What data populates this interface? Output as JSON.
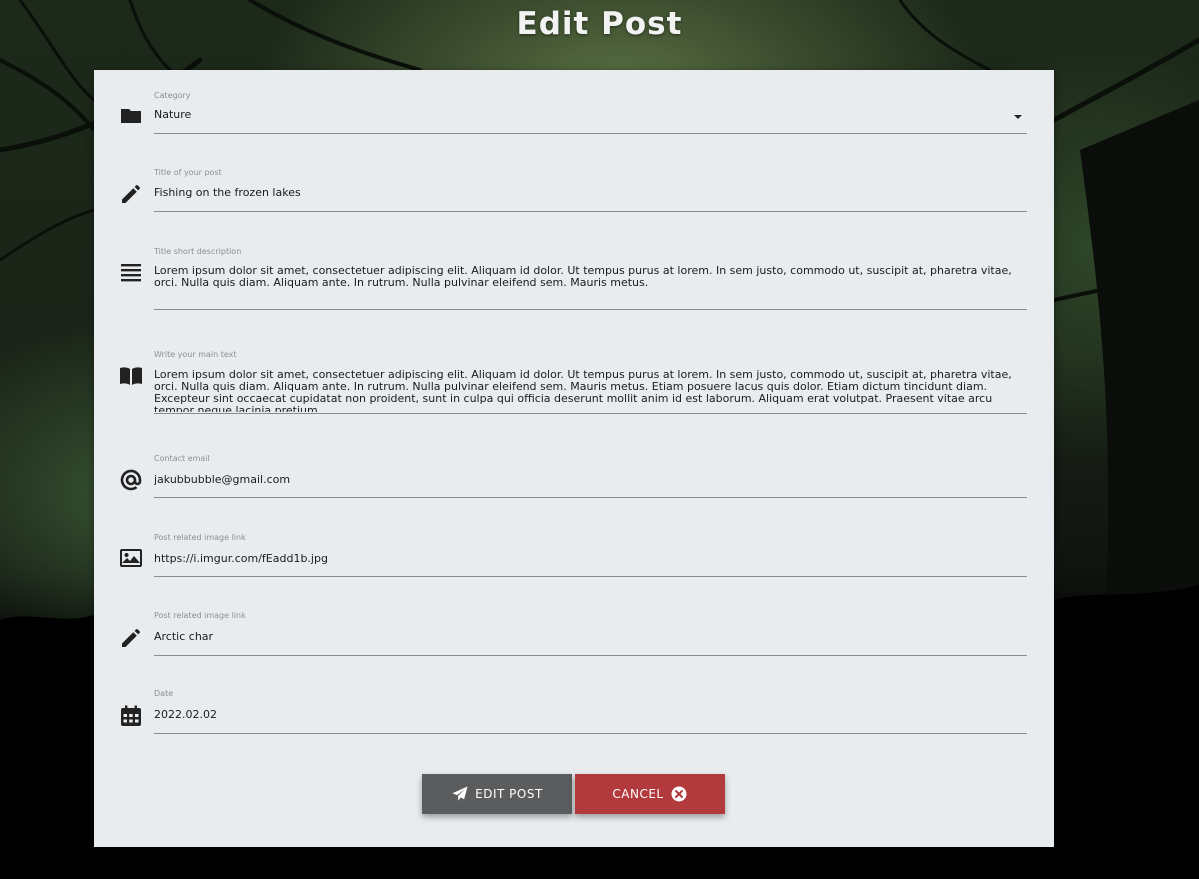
{
  "page": {
    "title": "Edit Post"
  },
  "form": {
    "fields": [
      {
        "label": "Category",
        "value": "Nature",
        "icon": "folder-icon"
      },
      {
        "label": "Title of your post",
        "value": "Fishing on the frozen lakes",
        "icon": "pencil-icon"
      },
      {
        "label": "Title short description",
        "value": "Lorem ipsum dolor sit amet, consectetuer adipiscing elit. Aliquam id dolor. Ut tempus purus at lorem. In sem justo, commodo ut, suscipit at, pharetra vitae, orci. Nulla quis diam. Aliquam ante. In rutrum. Nulla pulvinar eleifend sem. Mauris metus.",
        "icon": "align-justify-icon"
      },
      {
        "label": "Write your main text",
        "value": "Lorem ipsum dolor sit amet, consectetuer adipiscing elit. Aliquam id dolor. Ut tempus purus at lorem. In sem justo, commodo ut, suscipit at, pharetra vitae, orci. Nulla quis diam. Aliquam ante. In rutrum. Nulla pulvinar eleifend sem. Mauris metus. Etiam posuere lacus quis dolor. Etiam dictum tincidunt diam. Excepteur sint occaecat cupidatat non proident, sunt in culpa qui officia deserunt mollit anim id est laborum. Aliquam erat volutpat. Praesent vitae arcu tempor neque lacinia pretium.",
        "icon": "book-icon"
      },
      {
        "label": "Contact email",
        "value": "jakubbubble@gmail.com",
        "icon": "at-icon"
      },
      {
        "label": "Post related image link",
        "value": "https://i.imgur.com/fEadd1b.jpg",
        "icon": "image-icon"
      },
      {
        "label": "Post related image link",
        "value": "Arctic char",
        "icon": "pencil-icon"
      },
      {
        "label": "Date",
        "value": "2022.02.02",
        "icon": "calendar-icon"
      }
    ]
  },
  "buttons": {
    "edit_label": "EDIT POST",
    "edit_icon": "paper-plane-icon",
    "cancel_label": "CANCEL",
    "cancel_icon": "close-circle-icon"
  },
  "colors": {
    "card_bg": "#e9ecef",
    "edit_button": "#5b5c5e",
    "cancel_button": "#b23a3d"
  }
}
